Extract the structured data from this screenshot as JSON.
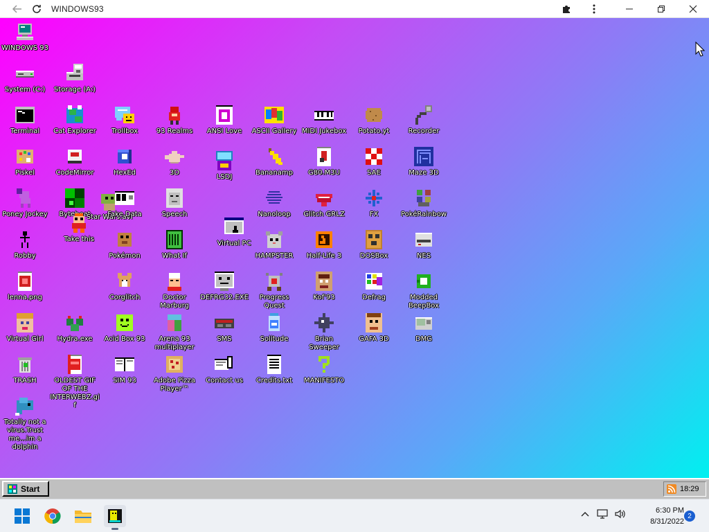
{
  "browser": {
    "title": "WINDOWS93",
    "back_icon": "arrow-left-icon",
    "reload_icon": "reload-icon"
  },
  "desktop": {
    "icons": [
      {
        "label": "WINDOWS 93",
        "icon": "computer-icon"
      },
      {
        "label": "System (C:)",
        "icon": "drive-icon"
      },
      {
        "label": "Storage (A:)",
        "icon": "floppy-drive-icon"
      },
      {
        "label": "Terminal",
        "icon": "terminal-icon"
      },
      {
        "label": "Cat Explorer",
        "icon": "cat-globe-icon"
      },
      {
        "label": "Trollbox",
        "icon": "chat-icon"
      },
      {
        "label": "93 Realms",
        "icon": "realms-icon"
      },
      {
        "label": "ANSI Love",
        "icon": "ansi-icon"
      },
      {
        "label": "ASCII Gallery",
        "icon": "ascii-icon"
      },
      {
        "label": "MIDI Jukebox",
        "icon": "piano-icon"
      },
      {
        "label": "Potato.yt",
        "icon": "potato-icon"
      },
      {
        "label": "Recorder",
        "icon": "microphone-icon"
      },
      {
        "label": "Piskel",
        "icon": "palette-icon"
      },
      {
        "label": "CodeMirror",
        "icon": "codemirror-icon"
      },
      {
        "label": "HexEd",
        "icon": "cube-icon"
      },
      {
        "label": "3D",
        "icon": "teapot-icon"
      },
      {
        "label": "LSDJ",
        "icon": "lsdj-icon"
      },
      {
        "label": "Bananamp",
        "icon": "banana-icon"
      },
      {
        "label": "G80.M3U",
        "icon": "music-file-icon"
      },
      {
        "label": "SAE",
        "icon": "amiga-ball-icon"
      },
      {
        "label": "Maze 3D",
        "icon": "maze-icon"
      },
      {
        "label": "Poney Jockey",
        "icon": "pony-icon"
      },
      {
        "label": "Bytebeat",
        "icon": "bytebeat-icon"
      },
      {
        "label": "Star Wars.avi",
        "icon": "yoda-icon"
      },
      {
        "label": "Fake Data",
        "icon": "fake-data-icon"
      },
      {
        "label": "Speech",
        "icon": "face-icon"
      },
      {
        "label": "Nanoloop",
        "icon": "wave-icon"
      },
      {
        "label": "Glitch GRLZ",
        "icon": "lips-icon"
      },
      {
        "label": "FX",
        "icon": "atom-icon"
      },
      {
        "label": "PokéRainbow",
        "icon": "pokerainbow-icon"
      },
      {
        "label": "Take this",
        "icon": "pixel-man-icon"
      },
      {
        "label": "Virtual PC",
        "icon": "window-cursor-icon"
      },
      {
        "label": "Robby",
        "icon": "stick-figure-icon"
      },
      {
        "label": "Pokémon",
        "icon": "pokemon-icon"
      },
      {
        "label": "What If",
        "icon": "what-if-icon"
      },
      {
        "label": "HAMPSTER",
        "icon": "hamster-icon"
      },
      {
        "label": "Half-Life 3",
        "icon": "lambda-icon"
      },
      {
        "label": "DOSBox",
        "icon": "dosbox-icon"
      },
      {
        "label": "NES",
        "icon": "nes-icon"
      },
      {
        "label": "lenna.png",
        "icon": "image-file-icon"
      },
      {
        "label": "Corglitch",
        "icon": "corgi-icon"
      },
      {
        "label": "Doctor Marburg",
        "icon": "doctor-icon"
      },
      {
        "label": "DEFRG32.EXE",
        "icon": "monitor-face-icon"
      },
      {
        "label": "Progress Quest",
        "icon": "swords-icon"
      },
      {
        "label": "Kof'93",
        "icon": "fighter-icon"
      },
      {
        "label": "Defrag",
        "icon": "defrag-icon"
      },
      {
        "label": "Modded BeepBox",
        "icon": "ring-icon"
      },
      {
        "label": "Virtual Girl",
        "icon": "girl-icon"
      },
      {
        "label": "Hydra.exe",
        "icon": "hydra-icon"
      },
      {
        "label": "Acid Box 93",
        "icon": "smiley-icon"
      },
      {
        "label": "Arena 93 multiplayer",
        "icon": "arena-cube-icon"
      },
      {
        "label": "SMS",
        "icon": "console-icon"
      },
      {
        "label": "Solitude",
        "icon": "jar-icon"
      },
      {
        "label": "Brian Sweeper",
        "icon": "mine-icon"
      },
      {
        "label": "GAFA 3D",
        "icon": "gafa-face-icon"
      },
      {
        "label": "DMG",
        "icon": "gameboy-icon"
      },
      {
        "label": "TRASH",
        "icon": "trash-icon"
      },
      {
        "label": "OLDEST GIF OF THE INTERWEBZ.gif",
        "icon": "gif-file-icon"
      },
      {
        "label": "SIM 93",
        "icon": "book-icon"
      },
      {
        "label": "Adobe Pizza Player™",
        "icon": "pizza-icon"
      },
      {
        "label": "Contact us",
        "icon": "contact-icon"
      },
      {
        "label": "Credits.txt",
        "icon": "text-file-icon"
      },
      {
        "label": "MANIFESTO",
        "icon": "question-icon"
      },
      {
        "label": "Totally not a virus.Trust me...im a dolphin",
        "icon": "dolphin-icon"
      }
    ]
  },
  "win93_taskbar": {
    "start_label": "Start",
    "clock": "18:29"
  },
  "windows_taskbar": {
    "time": "6:30 PM",
    "date": "8/31/2022",
    "notification_count": "2"
  },
  "colors": {
    "desktop_gradient_start": "#ff00ff",
    "desktop_gradient_end": "#00f0f0",
    "win93_gray": "#c0c0c0"
  }
}
